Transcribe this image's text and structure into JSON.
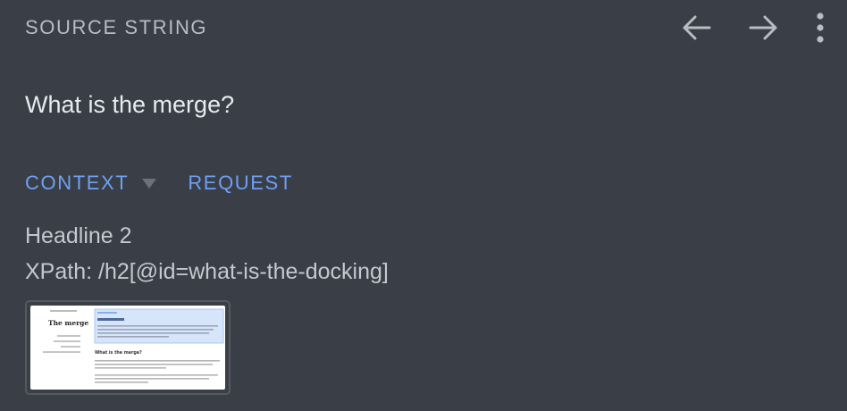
{
  "header": {
    "title": "SOURCE STRING",
    "icons": [
      "arrow-left-icon",
      "arrow-right-icon",
      "more-vertical-icon"
    ]
  },
  "source": {
    "text": "What is the merge?"
  },
  "tabs": [
    {
      "label": "CONTEXT",
      "has_dropdown": true
    },
    {
      "label": "REQUEST",
      "has_dropdown": false
    }
  ],
  "context": {
    "element_type": "Headline 2",
    "xpath": "XPath: /h2[@id=what-is-the-docking]"
  },
  "thumbnail": {
    "page_title": "The merge",
    "subheading": "What is the merge?"
  },
  "colors": {
    "background": "#3a3e47",
    "accent": "#6fa0f2",
    "muted_text": "#b9bcc3"
  }
}
